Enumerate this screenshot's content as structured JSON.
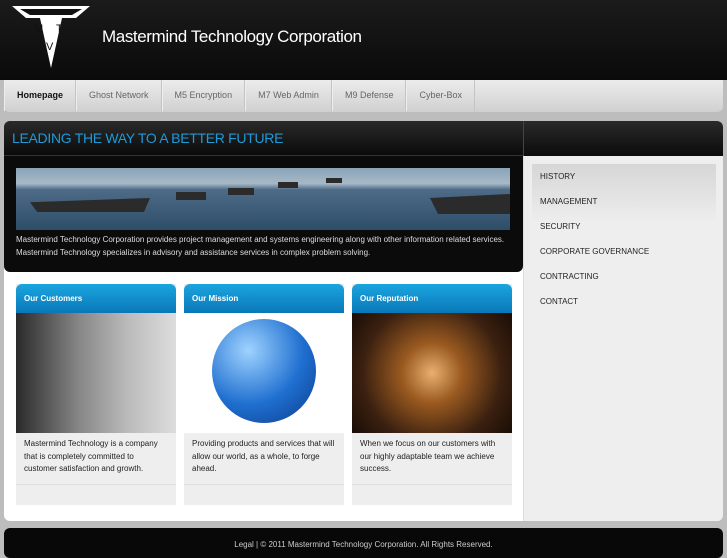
{
  "header": {
    "title": "Mastermind Technology Corporation",
    "logo_letters": "MTV"
  },
  "nav": {
    "items": [
      {
        "label": "Homepage",
        "active": true
      },
      {
        "label": "Ghost Network"
      },
      {
        "label": "M5 Encryption"
      },
      {
        "label": "M7 Web Admin"
      },
      {
        "label": "M9 Defense"
      },
      {
        "label": "Cyber-Box"
      }
    ]
  },
  "banner": {
    "tagline": "LEADING THE WAY TO A BETTER FUTURE",
    "intro": "Mastermind Technology Corporation provides project management and systems engineering along with other information related services. Mastermind Technology specializes in advisory and assistance services in complex problem solving."
  },
  "sidebar": {
    "items": [
      "HISTORY",
      "MANAGEMENT",
      "SECURITY",
      "CORPORATE GOVERNANCE",
      "CONTRACTING",
      "CONTACT"
    ]
  },
  "cards": [
    {
      "title": "Our Customers",
      "text": "Mastermind Technology is a company that is completely committed to customer satisfaction and growth."
    },
    {
      "title": "Our Mission",
      "text": "Providing products and services that will allow our world, as a whole, to forge ahead."
    },
    {
      "title": "Our Reputation",
      "text": "When we focus on our customers with our highly adaptable team we achieve success."
    }
  ],
  "footer": {
    "text": "Legal | © 2011 Mastermind Technology Corporation. All Rights Reserved."
  },
  "colors": {
    "accent": "#1e9ad8",
    "card_header": "#0f8fd0"
  }
}
